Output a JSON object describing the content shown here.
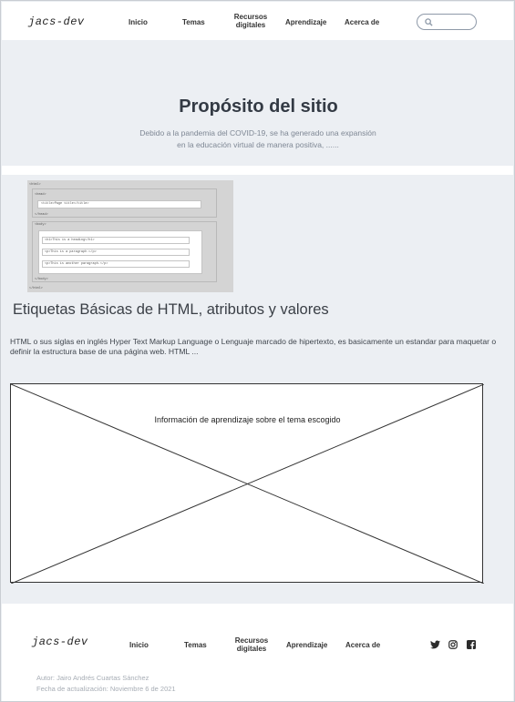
{
  "header": {
    "logo": "jacs-dev",
    "nav": [
      "Inicio",
      "Temas",
      "Recursos digitales",
      "Aprendizaje",
      "Acerca de"
    ],
    "search_placeholder": ""
  },
  "hero": {
    "title": "Propósito del sitio",
    "text_line1": "Debido a la pandemia del COVID-19, se ha generado una expansión",
    "text_line2": "en la educación virtual de manera positiva, ......"
  },
  "article": {
    "thumbnail_lines": [
      "<html>",
      "<head>",
      "<title>Page title</title>",
      "</head>",
      "<body>",
      "<h1>This is a heading</h1>",
      "<p>This is a paragraph.</p>",
      "<p>This is another paragraph.</p>",
      "</body>",
      "</html>"
    ],
    "title": "Etiquetas Básicas de HTML, atributos y valores",
    "text": "HTML o sus siglas en inglés Hyper Text Markup Language o Lenguaje marcado de hipertexto, es basicamente un estandar para maquetar o definir la estructura base de una página web. HTML ..."
  },
  "placeholder": {
    "label": "Información de aprendizaje sobre el tema escogido"
  },
  "footer": {
    "logo": "jacs-dev",
    "nav": [
      "Inicio",
      "Temas",
      "Recursos digitales",
      "Aprendizaje",
      "Acerca de"
    ],
    "social_icons": [
      "twitter-icon",
      "instagram-icon",
      "facebook-icon"
    ],
    "author": "Autor: Jairo Andrés Cuartas Sánchez",
    "updated": "Fecha de actualización: Noviembre 6 de 2021"
  }
}
